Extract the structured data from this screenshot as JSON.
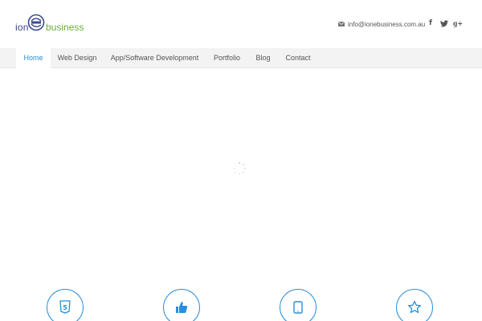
{
  "logo": {
    "part1": "ion",
    "part2": "business"
  },
  "header": {
    "email": "info@ionebusiness.com.au",
    "mail_icon": "mail-icon",
    "social": [
      {
        "name": "facebook-icon",
        "glyph": "f"
      },
      {
        "name": "twitter-icon",
        "glyph": "🐦"
      },
      {
        "name": "google-plus-icon",
        "glyph": "g+"
      }
    ]
  },
  "nav": {
    "items": [
      {
        "label": "Home",
        "active": true
      },
      {
        "label": "Web Design",
        "active": false
      },
      {
        "label": "App/Software Development",
        "active": false
      },
      {
        "label": "Portfolio",
        "active": false
      },
      {
        "label": "Blog",
        "active": false
      },
      {
        "label": "Contact",
        "active": false
      }
    ]
  },
  "slider": {
    "spinner_icon": "loading-spinner-icon"
  },
  "features": [
    {
      "icon": "html5-icon"
    },
    {
      "icon": "thumbs-up-icon"
    },
    {
      "icon": "tablet-icon"
    },
    {
      "icon": "star-icon"
    }
  ],
  "colors": {
    "accent": "#2a8fd6",
    "nav_bg": "#f3f3f3",
    "logo_blue": "#3a4a8c",
    "logo_green": "#6cae3e"
  }
}
